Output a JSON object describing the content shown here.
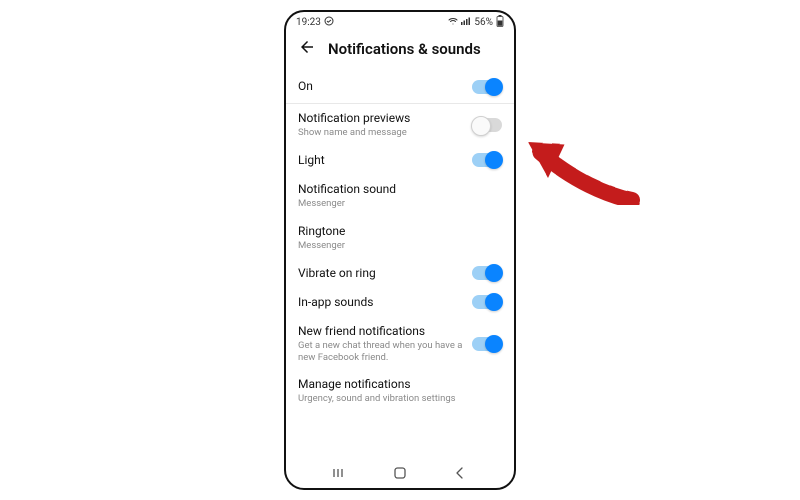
{
  "statusbar": {
    "time": "19:23",
    "battery": "56%"
  },
  "header": {
    "title": "Notifications & sounds"
  },
  "rows": {
    "on": {
      "title": "On"
    },
    "previews": {
      "title": "Notification previews",
      "sub": "Show name and message"
    },
    "light": {
      "title": "Light"
    },
    "sound": {
      "title": "Notification sound",
      "sub": "Messenger"
    },
    "ringtone": {
      "title": "Ringtone",
      "sub": "Messenger"
    },
    "vibrate": {
      "title": "Vibrate on ring"
    },
    "inapp": {
      "title": "In-app sounds"
    },
    "newfriend": {
      "title": "New friend notifications",
      "sub": "Get a new chat thread when you have a new Facebook friend."
    },
    "manage": {
      "title": "Manage notifications",
      "sub": "Urgency, sound and vibration settings"
    }
  }
}
